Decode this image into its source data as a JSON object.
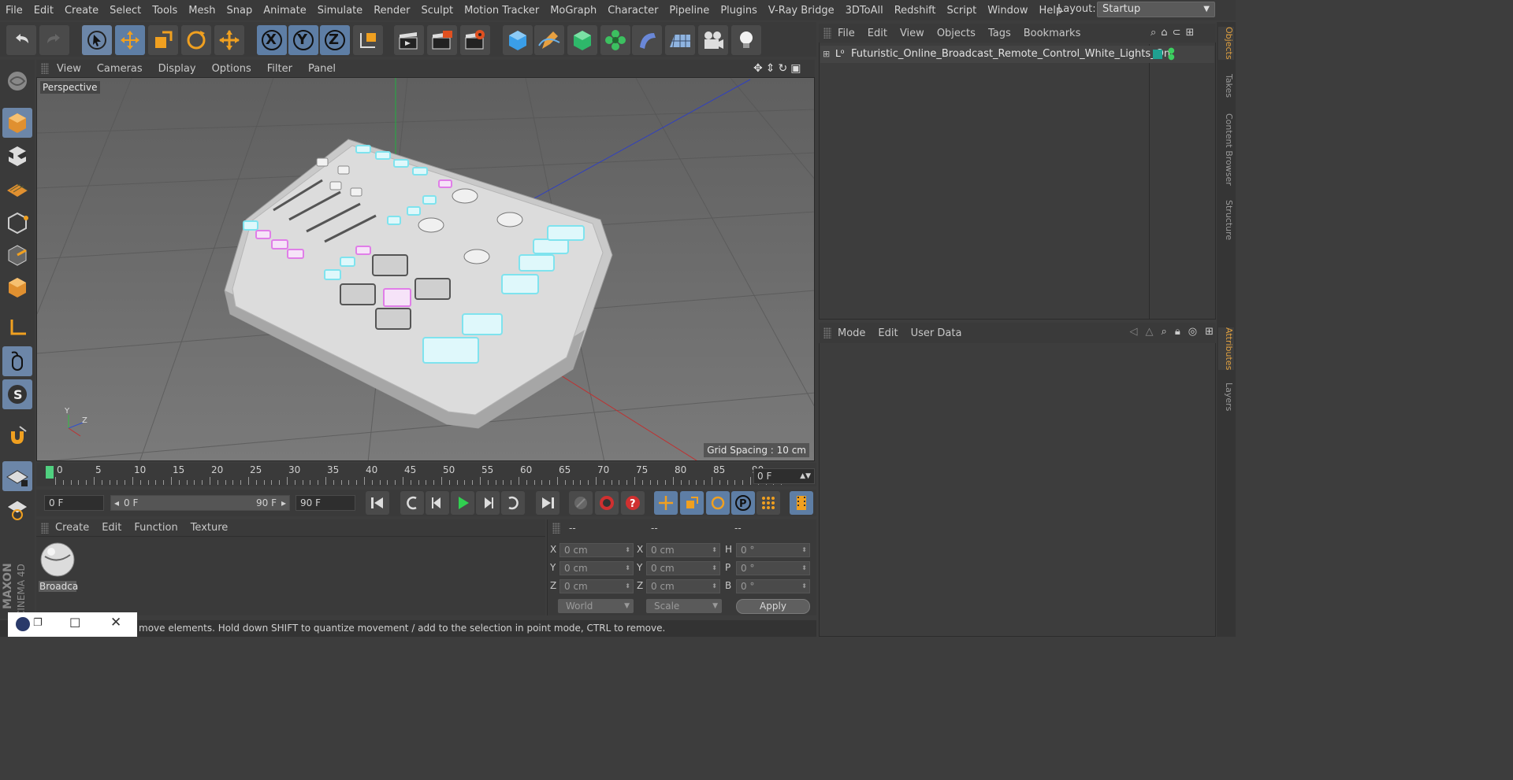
{
  "menu": [
    "File",
    "Edit",
    "Create",
    "Select",
    "Tools",
    "Mesh",
    "Snap",
    "Animate",
    "Simulate",
    "Render",
    "Sculpt",
    "Motion Tracker",
    "MoGraph",
    "Character",
    "Pipeline",
    "Plugins",
    "V-Ray Bridge",
    "3DToAll",
    "Redshift",
    "Script",
    "Window",
    "Help"
  ],
  "layout": {
    "label": "Layout:",
    "value": "Startup"
  },
  "toolbar": {
    "axis_x": "X",
    "axis_y": "Y",
    "axis_z": "Z"
  },
  "viewport": {
    "menu": [
      "View",
      "Cameras",
      "Display",
      "Options",
      "Filter",
      "Panel"
    ],
    "camera_label": "Perspective",
    "grid_spacing": "Grid Spacing : 10 cm",
    "axis_labels": {
      "y": "Y",
      "z": "Z"
    }
  },
  "timeline": {
    "ticks": [
      "0",
      "5",
      "10",
      "15",
      "20",
      "25",
      "30",
      "35",
      "40",
      "45",
      "50",
      "55",
      "60",
      "65",
      "70",
      "75",
      "80",
      "85",
      "90"
    ],
    "current_frame": "0 F"
  },
  "transport": {
    "start_field": "0 F",
    "range_start": "0 F",
    "range_end": "90 F",
    "end_field": "90 F"
  },
  "materials": {
    "menu": [
      "Create",
      "Edit",
      "Function",
      "Texture"
    ],
    "items": [
      {
        "label": "Broadca"
      }
    ]
  },
  "coordinates": {
    "headers": [
      "--",
      "--",
      "--"
    ],
    "rows": [
      {
        "l1": "X",
        "v1": "0 cm",
        "l2": "X",
        "v2": "0 cm",
        "l3": "H",
        "v3": "0 °"
      },
      {
        "l1": "Y",
        "v1": "0 cm",
        "l2": "Y",
        "v2": "0 cm",
        "l3": "P",
        "v3": "0 °"
      },
      {
        "l1": "Z",
        "v1": "0 cm",
        "l2": "Z",
        "v2": "0 cm",
        "l3": "B",
        "v3": "0 °"
      }
    ],
    "space": "World",
    "mode": "Scale",
    "apply": "Apply"
  },
  "status": {
    "text": "move elements. Hold down SHIFT to quantize movement / add to the selection in point mode, CTRL to remove."
  },
  "objects": {
    "menu": [
      "File",
      "Edit",
      "View",
      "Objects",
      "Tags",
      "Bookmarks"
    ],
    "items": [
      {
        "name": "Futuristic_Online_Broadcast_Remote_Control_White_Lights_On"
      }
    ]
  },
  "attributes": {
    "menu": [
      "Mode",
      "Edit",
      "User Data"
    ]
  },
  "side_tabs": [
    "Objects",
    "Takes",
    "Content Browser",
    "Structure",
    "Attributes",
    "Layers"
  ],
  "brand": {
    "line1": "MAXON",
    "line2": "CINEMA 4D"
  },
  "colors": {
    "accent": "#6c86a8",
    "active_tab": "#e0a040",
    "light_cyan": "#7fe3ee",
    "light_magenta": "#e07ee8"
  }
}
